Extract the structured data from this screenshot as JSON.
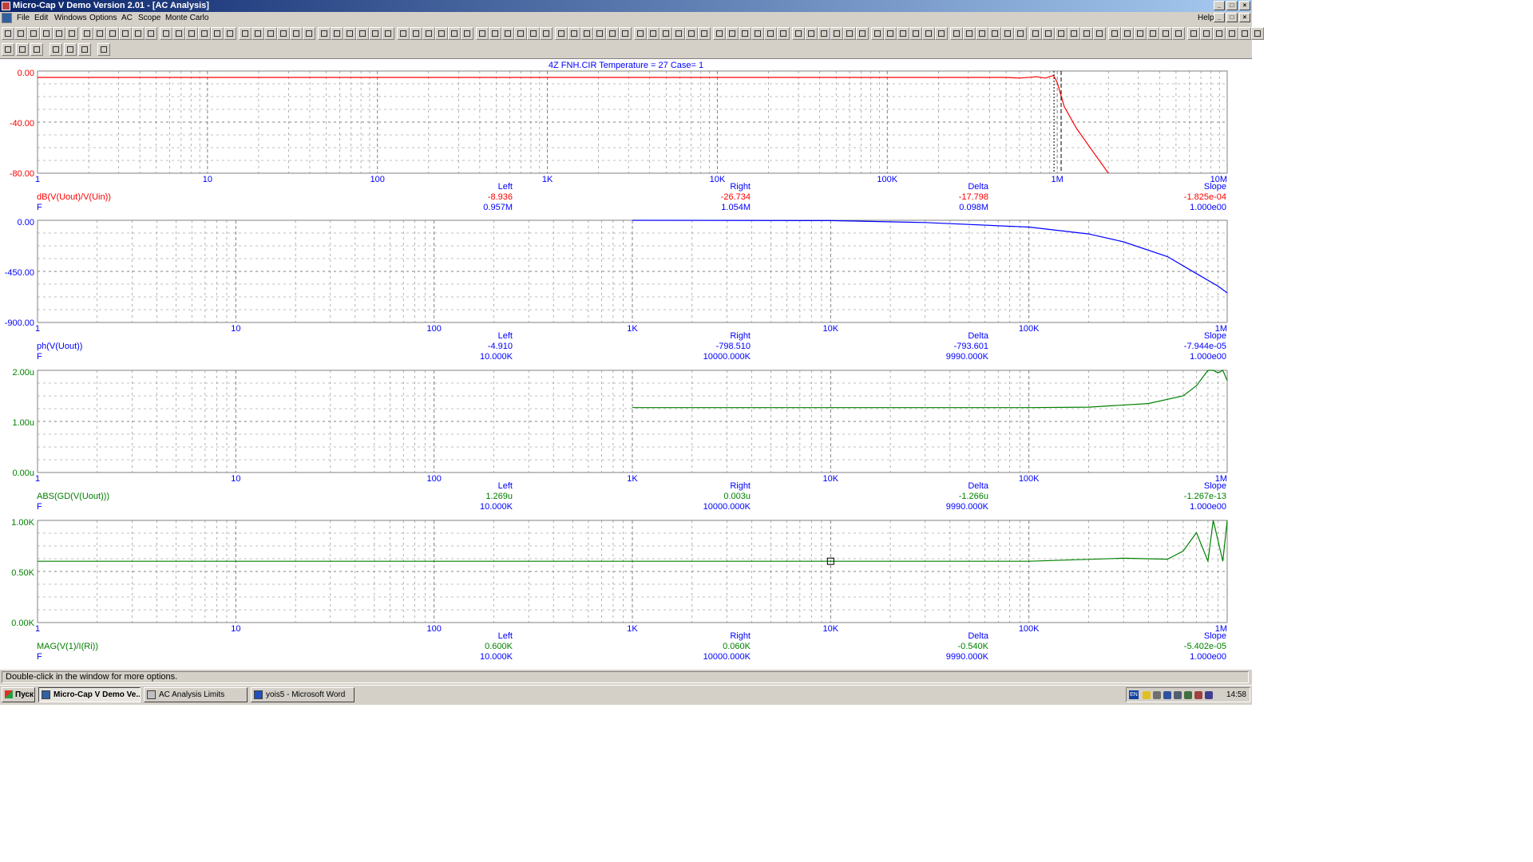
{
  "window": {
    "title": "Micro-Cap V Demo Version 2.01 - [AC Analysis]",
    "menu": [
      "File",
      "Edit",
      "Windows",
      "Options",
      "AC",
      "Scope",
      "Monte Carlo"
    ],
    "help": "Help"
  },
  "plot_title": "4Z  FNH.CIR Temperature = 27 Case= 1",
  "colors": {
    "red": "#ff0000",
    "blue": "#0000ff",
    "green": "#008000",
    "grid": "#808080"
  },
  "panels": [
    {
      "expr": "dB(V(Uout)/V(Uin))",
      "var": "F",
      "color": "#ff0000",
      "y_labels": [
        "0.00",
        "-40.00",
        "-80.00"
      ],
      "x_labels": [
        "1",
        "10",
        "100",
        "1K",
        "10K",
        "100K",
        "1M",
        "10M"
      ],
      "readout": {
        "left_h": "Left",
        "right_h": "Right",
        "delta_h": "Delta",
        "slope_h": "Slope",
        "left_y": "-8.936",
        "right_y": "-26.734",
        "delta_y": "-17.798",
        "slope_y": "-1.825e-04",
        "left_x": "0.957M",
        "right_x": "1.054M",
        "delta_x": "0.098M",
        "slope_x": "1.000e00"
      }
    },
    {
      "expr": "ph(V(Uout))",
      "var": "F",
      "color": "#0000ff",
      "y_labels": [
        "0.00",
        "-450.00",
        "-900.00"
      ],
      "x_labels": [
        "1",
        "10",
        "100",
        "1K",
        "10K",
        "100K",
        "1M"
      ],
      "readout": {
        "left_h": "Left",
        "right_h": "Right",
        "delta_h": "Delta",
        "slope_h": "Slope",
        "left_y": "-4.910",
        "right_y": "-798.510",
        "delta_y": "-793.601",
        "slope_y": "-7.944e-05",
        "left_x": "10.000K",
        "right_x": "10000.000K",
        "delta_x": "9990.000K",
        "slope_x": "1.000e00"
      }
    },
    {
      "expr": "ABS(GD(V(Uout)))",
      "var": "F",
      "color": "#008000",
      "y_labels": [
        "2.00u",
        "1.00u",
        "0.00u"
      ],
      "x_labels": [
        "1",
        "10",
        "100",
        "1K",
        "10K",
        "100K",
        "1M"
      ],
      "readout": {
        "left_h": "Left",
        "right_h": "Right",
        "delta_h": "Delta",
        "slope_h": "Slope",
        "left_y": "1.269u",
        "right_y": "0.003u",
        "delta_y": "-1.266u",
        "slope_y": "-1.267e-13",
        "left_x": "10.000K",
        "right_x": "10000.000K",
        "delta_x": "9990.000K",
        "slope_x": "1.000e00"
      }
    },
    {
      "expr": "MAG(V(1)/I(Ri))",
      "var": "F",
      "color": "#008000",
      "y_labels": [
        "1.00K",
        "0.50K",
        "0.00K"
      ],
      "x_labels": [
        "1",
        "10",
        "100",
        "1K",
        "10K",
        "100K",
        "1M"
      ],
      "readout": {
        "left_h": "Left",
        "right_h": "Right",
        "delta_h": "Delta",
        "slope_h": "Slope",
        "left_y": "0.600K",
        "right_y": "0.060K",
        "delta_y": "-0.540K",
        "slope_y": "-5.402e-05",
        "left_x": "10.000K",
        "right_x": "10000.000K",
        "delta_x": "9990.000K",
        "slope_x": "1.000e00"
      }
    }
  ],
  "chart_data": [
    {
      "type": "line",
      "ylabel": "dB(V(Uout)/V(Uin))",
      "xlabel": "F",
      "xscale": "log",
      "xlim": [
        1,
        10000000
      ],
      "ylim": [
        -80,
        0
      ],
      "series": [
        {
          "name": "dB(V(Uout)/V(Uin))",
          "x": [
            1,
            500000,
            600000,
            750000,
            850000,
            950000,
            1000000,
            1100000,
            1300000,
            1600000,
            2000000
          ],
          "y": [
            -5,
            -5,
            -5.5,
            -4.5,
            -5.5,
            -3.5,
            -8.9,
            -28,
            -45,
            -62,
            -80
          ]
        }
      ]
    },
    {
      "type": "line",
      "ylabel": "ph(V(Uout))",
      "xlabel": "F",
      "xscale": "log",
      "xlim": [
        1,
        1000000
      ],
      "ylim": [
        -900,
        0
      ],
      "series": [
        {
          "name": "ph(V(Uout))",
          "x": [
            1000,
            10000,
            30000,
            100000,
            200000,
            300000,
            500000,
            700000,
            900000,
            1000000
          ],
          "y": [
            0,
            -3,
            -20,
            -60,
            -120,
            -190,
            -320,
            -470,
            -580,
            -640
          ]
        }
      ]
    },
    {
      "type": "line",
      "ylabel": "ABS(GD(V(Uout)))",
      "xlabel": "F",
      "xscale": "log",
      "xlim": [
        1,
        1000000
      ],
      "ylim": [
        0,
        2
      ],
      "series": [
        {
          "name": "ABS(GD(V(Uout)))",
          "x": [
            1000,
            10000,
            100000,
            200000,
            400000,
            600000,
            700000,
            800000,
            850000,
            900000,
            950000,
            1000000
          ],
          "y": [
            1.27,
            1.27,
            1.27,
            1.28,
            1.35,
            1.5,
            1.7,
            2.0,
            2.0,
            1.95,
            2.0,
            1.8
          ]
        }
      ]
    },
    {
      "type": "line",
      "ylabel": "MAG(V(1)/I(Ri))",
      "xlabel": "F",
      "xscale": "log",
      "xlim": [
        1,
        1000000
      ],
      "ylim": [
        0,
        1
      ],
      "series": [
        {
          "name": "MAG(V(1)/I(Ri))",
          "x": [
            1,
            100000,
            300000,
            500000,
            600000,
            700000,
            800000,
            850000,
            900000,
            950000,
            1000000
          ],
          "y": [
            0.6,
            0.6,
            0.63,
            0.62,
            0.7,
            0.88,
            0.6,
            1.0,
            0.8,
            0.6,
            1.0
          ]
        }
      ]
    }
  ],
  "status": "Double-click in the window for more options.",
  "taskbar": {
    "start": "Пуск",
    "tasks": [
      "Micro-Cap V Demo Ve...",
      "AC Analysis Limits",
      "yois5 - Microsoft Word"
    ],
    "lang": "EN",
    "clock": "14:58"
  }
}
